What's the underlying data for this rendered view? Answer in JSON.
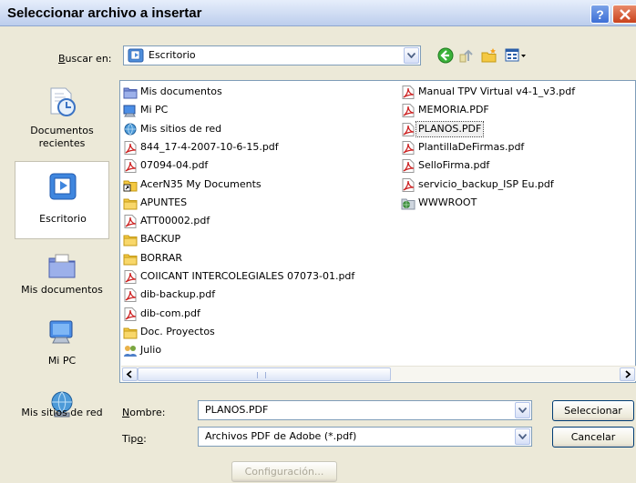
{
  "window": {
    "title": "Seleccionar archivo a insertar"
  },
  "lookin": {
    "label_pre": "",
    "label_u": "B",
    "label_post": "uscar en:",
    "value": "Escritorio"
  },
  "places": [
    {
      "line1": "Documentos",
      "line2": "recientes",
      "icon": "recent-documents-icon"
    },
    {
      "line1": "Escritorio",
      "line2": "",
      "icon": "desktop-icon"
    },
    {
      "line1": "Mis documentos",
      "line2": "",
      "icon": "my-documents-icon"
    },
    {
      "line1": "Mi PC",
      "line2": "",
      "icon": "my-computer-icon"
    },
    {
      "line1": "Mis sitios de red",
      "line2": "",
      "icon": "network-icon"
    }
  ],
  "files_col1": [
    {
      "name": "Mis documentos",
      "type": "mydocs"
    },
    {
      "name": "Mi PC",
      "type": "mypc"
    },
    {
      "name": "Mis sitios de red",
      "type": "network"
    },
    {
      "name": "844_17-4-2007-10-6-15.pdf",
      "type": "pdf"
    },
    {
      "name": "07094-04.pdf",
      "type": "pdf"
    },
    {
      "name": "AcerN35 My Documents",
      "type": "shortcut"
    },
    {
      "name": "APUNTES",
      "type": "folder"
    },
    {
      "name": "ATT00002.pdf",
      "type": "pdf"
    },
    {
      "name": "BACKUP",
      "type": "folder"
    },
    {
      "name": "BORRAR",
      "type": "folder"
    },
    {
      "name": "COIICANT INTERCOLEGIALES 07073-01.pdf",
      "type": "pdf"
    },
    {
      "name": "dib-backup.pdf",
      "type": "pdf"
    },
    {
      "name": "dib-com.pdf",
      "type": "pdf"
    },
    {
      "name": "Doc. Proyectos",
      "type": "folder"
    },
    {
      "name": "Julio",
      "type": "people"
    }
  ],
  "files_col2": [
    {
      "name": "Manual TPV Virtual v4-1_v3.pdf",
      "type": "pdf"
    },
    {
      "name": "MEMORIA.PDF",
      "type": "pdf"
    },
    {
      "name": "PLANOS.PDF",
      "type": "pdf",
      "selected": true
    },
    {
      "name": "PlantillaDeFirmas.pdf",
      "type": "pdf"
    },
    {
      "name": "SelloFirma.pdf",
      "type": "pdf"
    },
    {
      "name": "servicio_backup_ISP Eu.pdf",
      "type": "pdf"
    },
    {
      "name": "WWWROOT",
      "type": "webfolder"
    }
  ],
  "filename": {
    "label_u": "N",
    "label_post": "ombre:",
    "value": "PLANOS.PDF"
  },
  "filetype": {
    "label_pre": "Tip",
    "label_u": "o",
    "label_post": ":",
    "value": "Archivos PDF de Adobe (*.pdf)"
  },
  "buttons": {
    "select": "Seleccionar",
    "cancel": "Cancelar",
    "config": "Configuración..."
  },
  "colors": {
    "accent": "#316ac5",
    "pdf_red": "#cc2020",
    "folder_yellow": "#f4c842"
  }
}
